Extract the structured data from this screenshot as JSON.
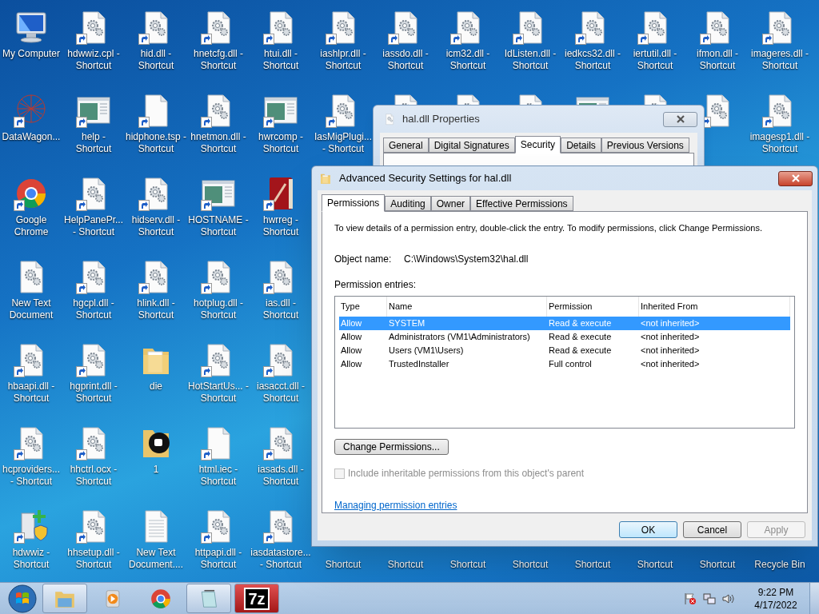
{
  "desktop": {
    "rows": [
      [
        {
          "label": "My Computer",
          "kind": "computer",
          "shortcut": false
        },
        {
          "label": "hdwwiz.cpl - Shortcut",
          "kind": "gear-doc",
          "shortcut": true
        },
        {
          "label": "hid.dll - Shortcut",
          "kind": "gear-doc",
          "shortcut": true
        },
        {
          "label": "hnetcfg.dll - Shortcut",
          "kind": "gear-doc",
          "shortcut": true
        },
        {
          "label": "htui.dll - Shortcut",
          "kind": "gear-doc",
          "shortcut": true
        },
        {
          "label": "iashlpr.dll - Shortcut",
          "kind": "gear-doc",
          "shortcut": true
        },
        {
          "label": "iassdo.dll - Shortcut",
          "kind": "gear-doc",
          "shortcut": true
        },
        {
          "label": "icm32.dll - Shortcut",
          "kind": "gear-doc",
          "shortcut": true
        },
        {
          "label": "IdListen.dll - Shortcut",
          "kind": "gear-doc",
          "shortcut": true
        },
        {
          "label": "iedkcs32.dll - Shortcut",
          "kind": "gear-doc",
          "shortcut": true
        },
        {
          "label": "iertutil.dll - Shortcut",
          "kind": "gear-doc",
          "shortcut": true
        },
        {
          "label": "ifmon.dll - Shortcut",
          "kind": "gear-doc",
          "shortcut": true
        },
        {
          "label": "imageres.dll - Shortcut",
          "kind": "gear-doc",
          "shortcut": true
        }
      ],
      [
        {
          "label": "DataWagon...",
          "kind": "network",
          "shortcut": true
        },
        {
          "label": "help - Shortcut",
          "kind": "window",
          "shortcut": true
        },
        {
          "label": "hidphone.tsp - Shortcut",
          "kind": "blank-doc",
          "shortcut": true
        },
        {
          "label": "hnetmon.dll - Shortcut",
          "kind": "gear-doc",
          "shortcut": true
        },
        {
          "label": "hwrcomp - Shortcut",
          "kind": "window",
          "shortcut": true
        },
        {
          "label": "IasMigPlugi... - Shortcut",
          "kind": "gear-doc",
          "shortcut": true
        },
        {
          "kind": "gear-doc"
        },
        {
          "kind": "gear-doc"
        },
        {
          "kind": "gear-doc"
        },
        {
          "kind": "window"
        },
        {
          "kind": "gear-doc"
        },
        {
          "kind": "gear-doc",
          "shortcut": true
        },
        {
          "label": "imagesp1.dll - Shortcut",
          "kind": "gear-doc",
          "shortcut": true
        }
      ],
      [
        {
          "label": "Google Chrome",
          "kind": "browser",
          "shortcut": true
        },
        {
          "label": "HelpPanePr... - Shortcut",
          "kind": "gear-doc",
          "shortcut": true
        },
        {
          "label": "hidserv.dll - Shortcut",
          "kind": "gear-doc",
          "shortcut": true
        },
        {
          "label": "HOSTNAME - Shortcut",
          "kind": "window",
          "shortcut": true
        },
        {
          "label": "hwrreg - Shortcut",
          "kind": "book",
          "shortcut": true
        }
      ],
      [
        {
          "label": "New Text Document",
          "kind": "gear-doc",
          "shortcut": false
        },
        {
          "label": "hgcpl.dll - Shortcut",
          "kind": "gear-doc",
          "shortcut": true
        },
        {
          "label": "hlink.dll - Shortcut",
          "kind": "gear-doc",
          "shortcut": true
        },
        {
          "label": "hotplug.dll - Shortcut",
          "kind": "gear-doc",
          "shortcut": true
        },
        {
          "label": "ias.dll - Shortcut",
          "kind": "gear-doc",
          "shortcut": true
        }
      ],
      [
        {
          "label": "hbaapi.dll - Shortcut",
          "kind": "gear-doc",
          "shortcut": true
        },
        {
          "label": "hgprint.dll - Shortcut",
          "kind": "gear-doc",
          "shortcut": true
        },
        {
          "label": "die",
          "kind": "folder",
          "shortcut": false
        },
        {
          "label": "HotStartUs... - Shortcut",
          "kind": "gear-doc",
          "shortcut": true
        },
        {
          "label": "iasacct.dll - Shortcut",
          "kind": "gear-doc",
          "shortcut": true
        }
      ],
      [
        {
          "label": "hcproviders... - Shortcut",
          "kind": "gear-doc",
          "shortcut": true
        },
        {
          "label": "hhctrl.ocx - Shortcut",
          "kind": "gear-doc",
          "shortcut": true
        },
        {
          "label": "1",
          "kind": "folder-dark",
          "shortcut": false
        },
        {
          "label": "html.iec - Shortcut",
          "kind": "blank-doc",
          "shortcut": true
        },
        {
          "label": "iasads.dll - Shortcut",
          "kind": "gear-doc",
          "shortcut": true
        }
      ],
      [
        {
          "label": "hdwwiz - Shortcut",
          "kind": "installer",
          "shortcut": true
        },
        {
          "label": "hhsetup.dll - Shortcut",
          "kind": "gear-doc",
          "shortcut": true
        },
        {
          "label": "New Text Document....",
          "kind": "text-doc",
          "shortcut": false
        },
        {
          "label": "httpapi.dll - Shortcut",
          "kind": "gear-doc",
          "shortcut": true
        },
        {
          "label": "iasdatastore... - Shortcut",
          "kind": "gear-doc",
          "shortcut": true
        },
        {
          "label": "Shortcut"
        },
        {
          "label": "Shortcut"
        },
        {
          "label": "Shortcut"
        },
        {
          "label": "Shortcut"
        },
        {
          "label": "Shortcut"
        },
        {
          "label": "Shortcut"
        },
        {
          "label": "Shortcut"
        },
        {
          "label": "Recycle Bin"
        }
      ]
    ]
  },
  "properties_window": {
    "title": "hal.dll Properties",
    "tabs": [
      {
        "label": "General",
        "selected": false
      },
      {
        "label": "Digital Signatures",
        "selected": false
      },
      {
        "label": "Security",
        "selected": true
      },
      {
        "label": "Details",
        "selected": false
      },
      {
        "label": "Previous Versions",
        "selected": false
      }
    ]
  },
  "advanced_window": {
    "title": "Advanced Security Settings for hal.dll",
    "tabs": [
      {
        "label": "Permissions",
        "selected": true
      },
      {
        "label": "Auditing",
        "selected": false
      },
      {
        "label": "Owner",
        "selected": false
      },
      {
        "label": "Effective Permissions",
        "selected": false
      }
    ],
    "instructions": "To view details of a permission entry, double-click the entry. To modify permissions, click Change Permissions.",
    "object_name_label": "Object name:",
    "object_name": "C:\\Windows\\System32\\hal.dll",
    "entries_label": "Permission entries:",
    "table": {
      "columns": [
        "Type",
        "Name",
        "Permission",
        "Inherited From"
      ],
      "rows": [
        {
          "cells": [
            "Allow",
            "SYSTEM",
            "Read & execute",
            "<not inherited>"
          ],
          "selected": true
        },
        {
          "cells": [
            "Allow",
            "Administrators (VM1\\Administrators)",
            "Read & execute",
            "<not inherited>"
          ],
          "selected": false
        },
        {
          "cells": [
            "Allow",
            "Users (VM1\\Users)",
            "Read & execute",
            "<not inherited>"
          ],
          "selected": false
        },
        {
          "cells": [
            "Allow",
            "TrustedInstaller",
            "Full control",
            "<not inherited>"
          ],
          "selected": false
        }
      ]
    },
    "change_button": "Change Permissions...",
    "inherit_checkbox": {
      "label": "Include inheritable permissions from this object's parent",
      "checked": false,
      "disabled": true
    },
    "help_link": "Managing permission entries",
    "buttons": [
      {
        "label": "OK",
        "default": true,
        "disabled": false
      },
      {
        "label": "Cancel",
        "default": false,
        "disabled": false
      },
      {
        "label": "Apply",
        "default": false,
        "disabled": true
      }
    ]
  },
  "taskbar": {
    "items": [
      {
        "kind": "explorer",
        "running": true,
        "active": false
      },
      {
        "kind": "media",
        "running": false,
        "active": false
      },
      {
        "kind": "browser",
        "running": false,
        "active": false
      },
      {
        "kind": "notepad",
        "running": true,
        "active": false
      },
      {
        "kind": "archive",
        "label": "7z",
        "running": true,
        "active": true
      }
    ],
    "time": "9:22 PM",
    "date": "4/17/2022"
  }
}
